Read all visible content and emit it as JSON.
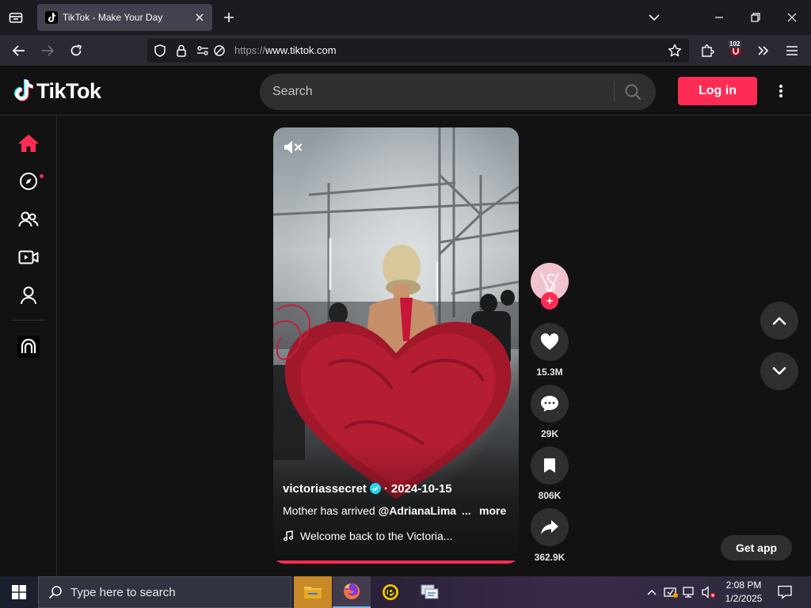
{
  "browser": {
    "tab": {
      "title": "TikTok - Make Your Day"
    },
    "url": {
      "scheme": "https://",
      "host": "www.tiktok.com"
    },
    "extension_badge": "102"
  },
  "header": {
    "brand": "TikTok",
    "search": {
      "placeholder": "Search"
    },
    "login_label": "Log in"
  },
  "sidebar": {
    "items": [
      {
        "name": "For You",
        "icon": "home-icon",
        "active": true
      },
      {
        "name": "Explore",
        "icon": "compass-icon",
        "has_dot": true
      },
      {
        "name": "Following",
        "icon": "people-icon"
      },
      {
        "name": "LIVE",
        "icon": "live-video-icon"
      },
      {
        "name": "Profile",
        "icon": "profile-icon"
      }
    ]
  },
  "video": {
    "username": "victoriassecret",
    "separator": "·",
    "date": "2024-10-15",
    "description": "Mother has arrived ",
    "mention": "@AdrianaLima",
    "ellipsis": "...",
    "more_label": "more",
    "music": "Welcome back to the Victoria...",
    "progress": 0.99
  },
  "actions": {
    "likes": "15.3M",
    "comments": "29K",
    "saves": "806K",
    "shares": "362.9K"
  },
  "get_app_label": "Get app",
  "taskbar": {
    "search_placeholder": "Type here to search",
    "time": "2:08 PM",
    "date": "1/2/2025"
  },
  "colors": {
    "accent": "#fe2c55",
    "background": "#121212",
    "surface": "#2f2f2f"
  }
}
